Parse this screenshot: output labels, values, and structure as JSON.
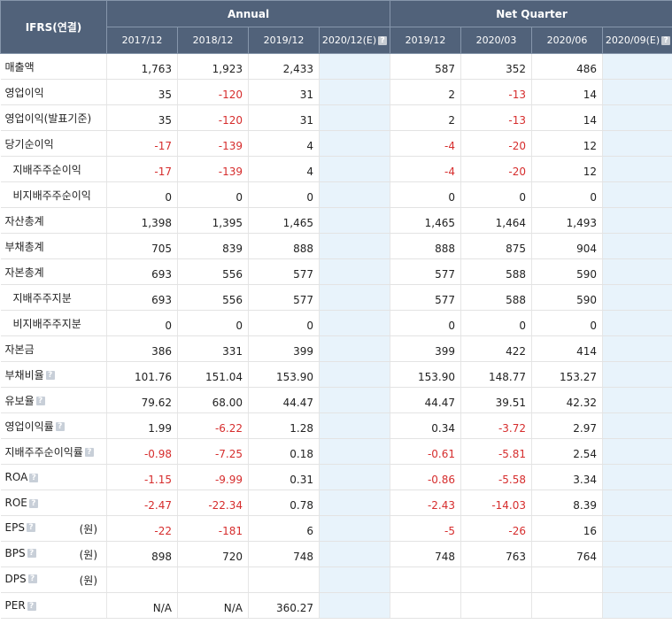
{
  "header": {
    "corner": "IFRS(연결)",
    "group_annual": "Annual",
    "group_quarter": "Net Quarter",
    "periods": [
      "2017/12",
      "2018/12",
      "2019/12",
      "2020/12(E)",
      "2019/12",
      "2020/03",
      "2020/06",
      "2020/09(E)"
    ]
  },
  "colors": {
    "header_bg": "#51627a",
    "estimate_bg": "#e8f3fb",
    "negative": "#d62d2d"
  },
  "rows": [
    {
      "label": "매출액",
      "sub": false,
      "help": false,
      "unit": "",
      "values": [
        "1,763",
        "1,923",
        "2,433",
        "",
        "587",
        "352",
        "486",
        ""
      ]
    },
    {
      "label": "영업이익",
      "sub": false,
      "help": false,
      "unit": "",
      "values": [
        "35",
        "-120",
        "31",
        "",
        "2",
        "-13",
        "14",
        ""
      ]
    },
    {
      "label": "영업이익(발표기준)",
      "sub": false,
      "help": false,
      "unit": "",
      "values": [
        "35",
        "-120",
        "31",
        "",
        "2",
        "-13",
        "14",
        ""
      ]
    },
    {
      "label": "당기순이익",
      "sub": false,
      "help": false,
      "unit": "",
      "values": [
        "-17",
        "-139",
        "4",
        "",
        "-4",
        "-20",
        "12",
        ""
      ]
    },
    {
      "label": "지배주주순이익",
      "sub": true,
      "help": false,
      "unit": "",
      "values": [
        "-17",
        "-139",
        "4",
        "",
        "-4",
        "-20",
        "12",
        ""
      ]
    },
    {
      "label": "비지배주주순이익",
      "sub": true,
      "help": false,
      "unit": "",
      "values": [
        "0",
        "0",
        "0",
        "",
        "0",
        "0",
        "0",
        ""
      ]
    },
    {
      "label": "자산총계",
      "sub": false,
      "help": false,
      "unit": "",
      "values": [
        "1,398",
        "1,395",
        "1,465",
        "",
        "1,465",
        "1,464",
        "1,493",
        ""
      ]
    },
    {
      "label": "부채총계",
      "sub": false,
      "help": false,
      "unit": "",
      "values": [
        "705",
        "839",
        "888",
        "",
        "888",
        "875",
        "904",
        ""
      ]
    },
    {
      "label": "자본총계",
      "sub": false,
      "help": false,
      "unit": "",
      "values": [
        "693",
        "556",
        "577",
        "",
        "577",
        "588",
        "590",
        ""
      ]
    },
    {
      "label": "지배주주지분",
      "sub": true,
      "help": false,
      "unit": "",
      "values": [
        "693",
        "556",
        "577",
        "",
        "577",
        "588",
        "590",
        ""
      ]
    },
    {
      "label": "비지배주주지분",
      "sub": true,
      "help": false,
      "unit": "",
      "values": [
        "0",
        "0",
        "0",
        "",
        "0",
        "0",
        "0",
        ""
      ]
    },
    {
      "label": "자본금",
      "sub": false,
      "help": false,
      "unit": "",
      "values": [
        "386",
        "331",
        "399",
        "",
        "399",
        "422",
        "414",
        ""
      ]
    },
    {
      "label": "부채비율",
      "sub": false,
      "help": true,
      "unit": "",
      "values": [
        "101.76",
        "151.04",
        "153.90",
        "",
        "153.90",
        "148.77",
        "153.27",
        ""
      ]
    },
    {
      "label": "유보율",
      "sub": false,
      "help": true,
      "unit": "",
      "values": [
        "79.62",
        "68.00",
        "44.47",
        "",
        "44.47",
        "39.51",
        "42.32",
        ""
      ]
    },
    {
      "label": "영업이익률",
      "sub": false,
      "help": true,
      "unit": "",
      "values": [
        "1.99",
        "-6.22",
        "1.28",
        "",
        "0.34",
        "-3.72",
        "2.97",
        ""
      ]
    },
    {
      "label": "지배주주순이익률",
      "sub": false,
      "help": true,
      "unit": "",
      "values": [
        "-0.98",
        "-7.25",
        "0.18",
        "",
        "-0.61",
        "-5.81",
        "2.54",
        ""
      ]
    },
    {
      "label": "ROA",
      "sub": false,
      "help": true,
      "unit": "",
      "values": [
        "-1.15",
        "-9.99",
        "0.31",
        "",
        "-0.86",
        "-5.58",
        "3.34",
        ""
      ]
    },
    {
      "label": "ROE",
      "sub": false,
      "help": true,
      "unit": "",
      "values": [
        "-2.47",
        "-22.34",
        "0.78",
        "",
        "-2.43",
        "-14.03",
        "8.39",
        ""
      ]
    },
    {
      "label": "EPS",
      "sub": false,
      "help": true,
      "unit": "(원)",
      "values": [
        "-22",
        "-181",
        "6",
        "",
        "-5",
        "-26",
        "16",
        ""
      ]
    },
    {
      "label": "BPS",
      "sub": false,
      "help": true,
      "unit": "(원)",
      "values": [
        "898",
        "720",
        "748",
        "",
        "748",
        "763",
        "764",
        ""
      ]
    },
    {
      "label": "DPS",
      "sub": false,
      "help": true,
      "unit": "(원)",
      "values": [
        "",
        "",
        "",
        "",
        "",
        "",
        "",
        ""
      ]
    },
    {
      "label": "PER",
      "sub": false,
      "help": true,
      "unit": "",
      "values": [
        "N/A",
        "N/A",
        "360.27",
        "",
        "",
        "",
        "",
        ""
      ]
    }
  ]
}
